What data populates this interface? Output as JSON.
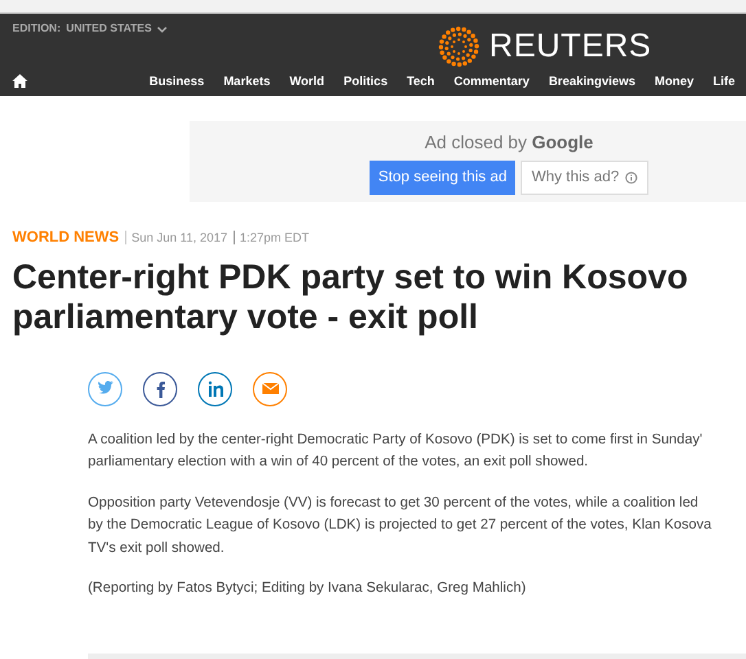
{
  "header": {
    "edition_label": "EDITION:",
    "edition": "UNITED STATES",
    "logo": "REUTERS",
    "nav": [
      "Business",
      "Markets",
      "World",
      "Politics",
      "Tech",
      "Commentary",
      "Breakingviews",
      "Money",
      "Life"
    ]
  },
  "ad": {
    "title_prefix": "Ad closed by",
    "title_brand": "Google",
    "buttons": [
      {
        "label": "Stop seeing this ad",
        "kind": "primary"
      },
      {
        "label": "Why this ad?",
        "kind": "info"
      }
    ]
  },
  "article": {
    "section": "WORLD NEWS",
    "date": "Sun Jun 11, 2017",
    "time": "1:27pm EDT",
    "headline": "Center-right PDK party set to win Kosovo parliamentary vote - exit poll",
    "share": [
      {
        "kind": "twitter"
      },
      {
        "kind": "facebook"
      },
      {
        "kind": "linkedin"
      },
      {
        "kind": "email"
      }
    ],
    "paragraphs": [
      [
        "A coalition led by the center-right Democratic Party of Kosovo (PDK) is set to come first in Sunday'",
        "parliamentary election with a win of 40 percent of the votes, an exit poll showed."
      ],
      [
        "Opposition party Vetevendosje (VV) is forecast to get 30 percent of the votes, while a coalition led",
        "by the Democratic League of Kosovo (LDK) is projected to get 27 percent of the votes, Klan Kosova",
        "TV's exit poll showed."
      ],
      [
        "(Reporting by Fatos Bytyci; Editing by Ivana Sekularac, Greg Mahlich)"
      ]
    ]
  }
}
